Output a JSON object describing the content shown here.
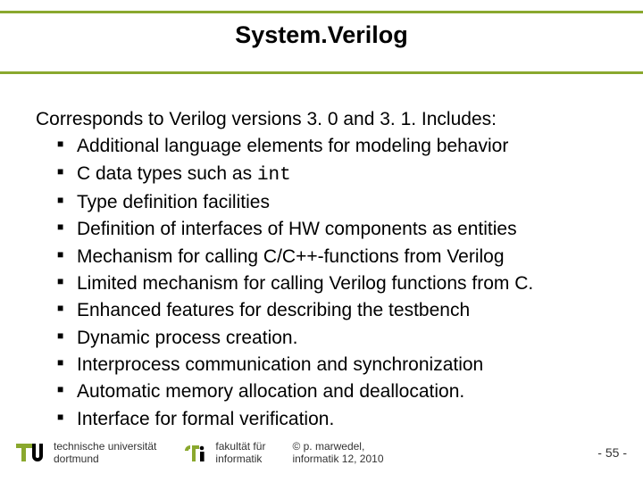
{
  "title": "System.Verilog",
  "intro": "Corresponds to Verilog versions 3. 0 and 3. 1. Includes:",
  "bullets": [
    {
      "pre": "Additional language elements for modeling behavior"
    },
    {
      "pre": "C data types such as ",
      "code": "int"
    },
    {
      "pre": "Type definition facilities"
    },
    {
      "pre": "Definition of interfaces of HW components as entities"
    },
    {
      "pre": "Mechanism for calling C/C++-functions from Verilog"
    },
    {
      "pre": "Limited mechanism for calling Verilog functions from C."
    },
    {
      "pre": "Enhanced features for describing the testbench"
    },
    {
      "pre": "Dynamic process creation."
    },
    {
      "pre": "Interprocess communication and synchronization"
    },
    {
      "pre": "Automatic memory allocation and deallocation."
    },
    {
      "pre": "Interface for formal verification."
    }
  ],
  "footer": {
    "org1_line1": "technische universität",
    "org1_line2": "dortmund",
    "org2_line1": "fakultät für",
    "org2_line2": "informatik",
    "credit_line1": "©  p. marwedel,",
    "credit_line2": "informatik 12,  2010",
    "page_prefix": "-  ",
    "page_number": "55",
    "page_suffix": " -"
  },
  "colors": {
    "accent": "#8aa82e"
  }
}
